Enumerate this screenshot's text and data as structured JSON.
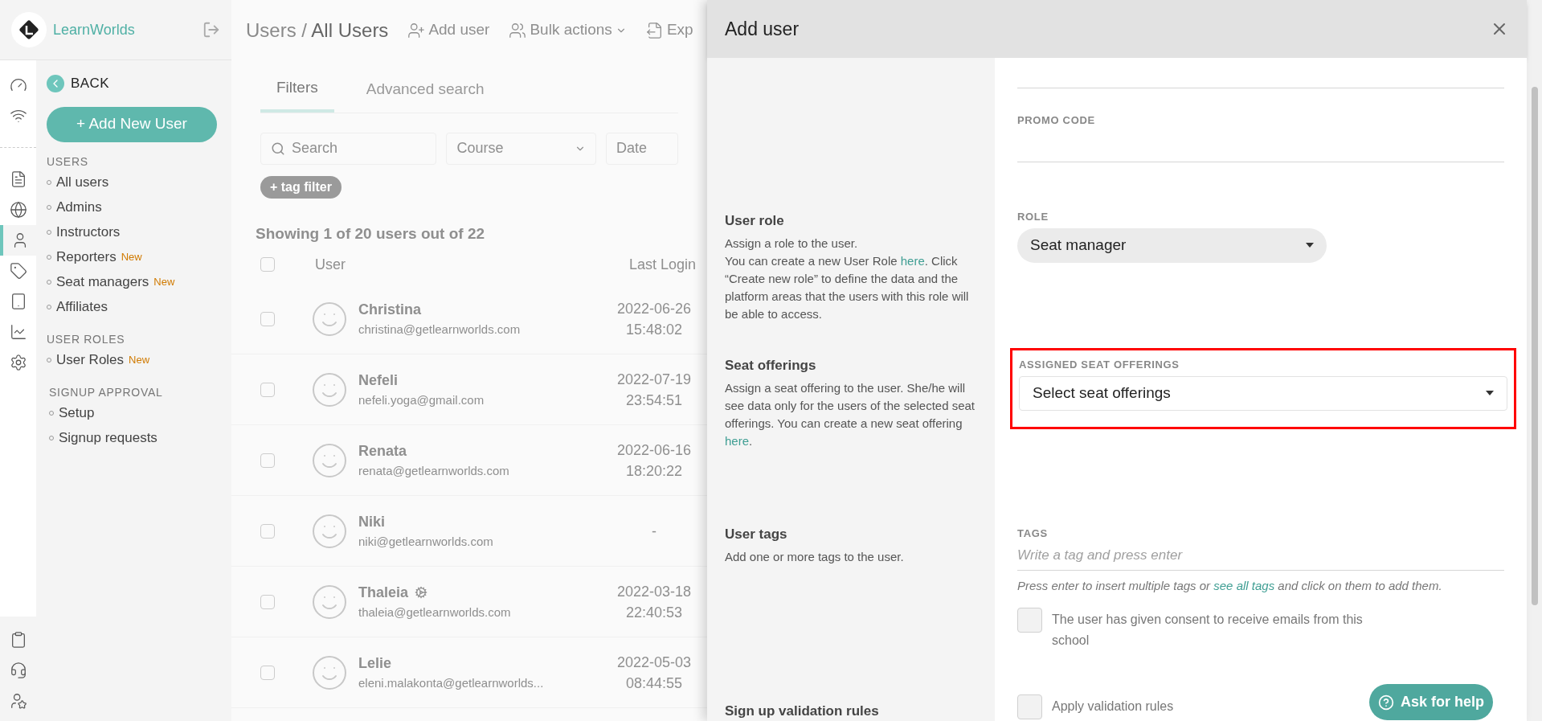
{
  "brand": {
    "name": "LearnWorlds"
  },
  "rail": {
    "top": [
      {
        "kind": "gauge",
        "selected": false
      },
      {
        "kind": "wifi",
        "selected": false
      }
    ],
    "main": [
      {
        "kind": "pages",
        "selected": false
      },
      {
        "kind": "globe",
        "selected": false
      },
      {
        "kind": "user",
        "selected": true
      },
      {
        "kind": "tag",
        "selected": false
      },
      {
        "kind": "tablet",
        "selected": false
      },
      {
        "kind": "chart",
        "selected": false
      },
      {
        "kind": "settings",
        "selected": false
      }
    ],
    "bottom": [
      {
        "kind": "clipboard",
        "selected": false
      },
      {
        "kind": "headset",
        "selected": false
      },
      {
        "kind": "user-star",
        "selected": false
      }
    ]
  },
  "sidebar": {
    "back": "BACK",
    "add_button": "Add New User",
    "add_icon": "+",
    "sections": [
      {
        "title": "USERS",
        "items": [
          {
            "label": "All users"
          },
          {
            "label": "Admins"
          },
          {
            "label": "Instructors"
          },
          {
            "label": "Reporters",
            "badge": "New"
          },
          {
            "label": "Seat managers",
            "badge": "New"
          },
          {
            "label": "Affiliates"
          }
        ]
      },
      {
        "title": "USER ROLES",
        "items": [
          {
            "label": "User Roles",
            "badge": "New"
          }
        ]
      },
      {
        "title": "SIGNUP APPROVAL",
        "items": [
          {
            "label": "Setup"
          },
          {
            "label": "Signup requests"
          }
        ]
      }
    ]
  },
  "page": {
    "breadcrumb": [
      "Users",
      "/",
      "All Users"
    ],
    "actions": [
      {
        "kind": "add",
        "label": "Add user",
        "caret": false
      },
      {
        "kind": "bulk",
        "label": "Bulk actions",
        "caret": true
      },
      {
        "kind": "export",
        "label": "Exp",
        "caret": false
      }
    ],
    "tabs": [
      {
        "label": "Filters",
        "selected": true
      },
      {
        "label": "Advanced search",
        "selected": false
      }
    ],
    "filters": {
      "search_placeholder": "Search",
      "course": "Course",
      "date": "Date",
      "tag_filter": "+ tag filter"
    },
    "showing": "Showing 1 of 20 users out of 22",
    "columns": [
      "User",
      "Last Login"
    ],
    "all_checked": false,
    "rows": [
      {
        "checked": false,
        "name": "Christina",
        "email": "christina@getlearnworlds.com",
        "login": [
          "2022-06-26",
          "15:48:02"
        ],
        "gear": false
      },
      {
        "checked": false,
        "name": "Nefeli",
        "email": "nefeli.yoga@gmail.com",
        "login": [
          "2022-07-19",
          "23:54:51"
        ],
        "gear": false
      },
      {
        "checked": false,
        "name": "Renata",
        "email": "renata@getlearnworlds.com",
        "login": [
          "2022-06-16",
          "18:20:22"
        ],
        "gear": false
      },
      {
        "checked": false,
        "name": "Niki",
        "email": "niki@getlearnworlds.com",
        "login": [
          "-"
        ],
        "gear": false
      },
      {
        "checked": false,
        "name": "Thaleia",
        "email": "thaleia@getlearnworlds.com",
        "login": [
          "2022-03-18",
          "22:40:53"
        ],
        "gear": true
      },
      {
        "checked": false,
        "name": "Lelie",
        "email": "eleni.malakonta@getlearnworlds...",
        "login": [
          "2022-05-03",
          "08:44:55"
        ],
        "gear": false
      }
    ]
  },
  "modal": {
    "title": "Add user",
    "sections": [
      {
        "kind": "fields",
        "fields": [
          {
            "kind": "line"
          },
          {
            "kind": "line",
            "label": "PROMO CODE"
          }
        ]
      },
      {
        "kind": "role",
        "title": "User role",
        "description": [
          [
            {
              "kind": "text",
              "text": "Assign a role to the user."
            }
          ],
          [
            {
              "kind": "text",
              "text": "You can create a new User Role "
            },
            {
              "kind": "link",
              "text": "here"
            },
            {
              "kind": "text",
              "text": ". Click “Create new role” to define the data and the platform areas that the users with this role will be able to access."
            }
          ]
        ],
        "label": "ROLE",
        "value": "Seat manager"
      },
      {
        "kind": "seats",
        "title": "Seat offerings",
        "description": [
          [
            {
              "kind": "text",
              "text": "Assign a seat offering to the user. She/he will see data only for the users of the selected seat offerings. You can create a new seat offering "
            },
            {
              "kind": "link",
              "text": "here"
            },
            {
              "kind": "text",
              "text": "."
            }
          ]
        ],
        "label": "ASSIGNED SEAT OFFERINGS",
        "value": "Select seat offerings",
        "highlighted": true
      },
      {
        "kind": "tags",
        "title": "User tags",
        "description": [
          [
            {
              "kind": "text",
              "text": "Add one or more tags to the user."
            }
          ]
        ],
        "label": "TAGS",
        "placeholder": "Write a tag and press enter",
        "help": [
          {
            "kind": "text",
            "text": "Press enter to insert multiple tags or "
          },
          {
            "kind": "link",
            "text": "see all tags"
          },
          {
            "kind": "text",
            "text": " and click on them to add them."
          }
        ],
        "consent": {
          "label": "The user has given consent to receive emails from this school",
          "checked": false
        }
      },
      {
        "kind": "validation",
        "title": "Sign up validation rules",
        "checkbox": {
          "label": "Apply validation rules",
          "checked": false
        }
      }
    ]
  },
  "help_button": "Ask for help"
}
